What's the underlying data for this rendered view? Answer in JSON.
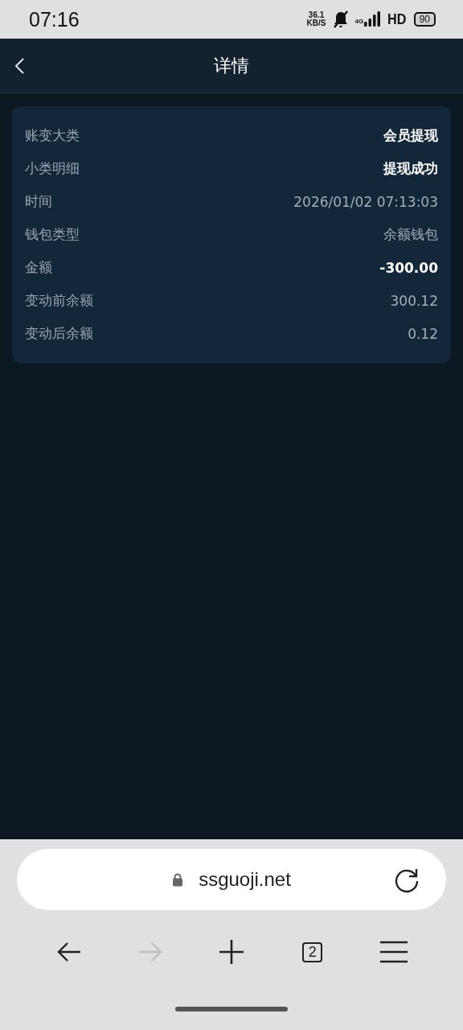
{
  "status_bar": {
    "time": "07:16",
    "speed_value": "36.1",
    "speed_unit": "KB/S",
    "network": "4G",
    "hd": "HD",
    "battery": "90"
  },
  "header": {
    "title": "详情"
  },
  "details": [
    {
      "label": "账变大类",
      "value": "会员提现",
      "emphasis": true
    },
    {
      "label": "小类明细",
      "value": "提现成功",
      "emphasis": true
    },
    {
      "label": "时间",
      "value": "2026/01/02 07:13:03",
      "emphasis": false
    },
    {
      "label": "钱包类型",
      "value": "余额钱包",
      "emphasis": false
    },
    {
      "label": "金额",
      "value": "-300.00",
      "emphasis": true
    },
    {
      "label": "变动前余额",
      "value": "300.12",
      "emphasis": false
    },
    {
      "label": "变动后余额",
      "value": "0.12",
      "emphasis": false
    }
  ],
  "browser": {
    "url": "ssguoji.net",
    "tab_count": "2",
    "toolbar": [
      {
        "kind": "back",
        "disabled": false
      },
      {
        "kind": "forward",
        "disabled": true
      },
      {
        "kind": "new-tab",
        "disabled": false
      },
      {
        "kind": "tabs",
        "disabled": false
      },
      {
        "kind": "menu",
        "disabled": false
      }
    ]
  }
}
